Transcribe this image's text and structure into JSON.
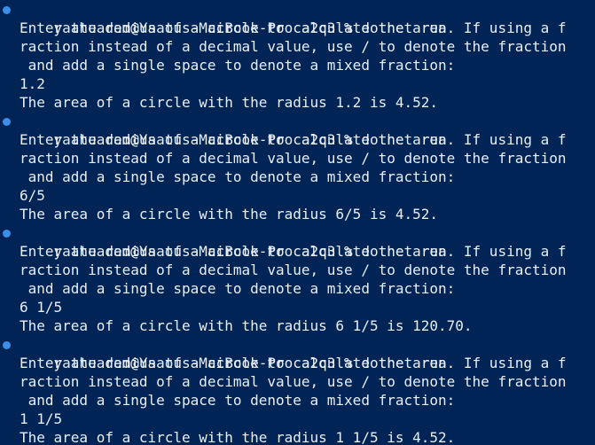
{
  "terminal": {
    "colors": {
      "background": "#012456",
      "text": "#e9eef6",
      "prompt_marker": "#3b8eea"
    },
    "sessions": [
      {
        "prompt": "yaatuadem@Yaatus-MacBook-Pro a2q3 % dotnet run",
        "output": [
          "Enter the radius of a circle to calculate the area. If using a f",
          "raction instead of a decimal value, use / to denote the fraction",
          " and add a single space to denote a mixed fraction:",
          "1.2",
          "The area of a circle with the radius 1.2 is 4.52."
        ]
      },
      {
        "prompt": "yaatuadem@Yaatus-MacBook-Pro a2q3 % dotnet run",
        "output": [
          "Enter the radius of a circle to calculate the area. If using a f",
          "raction instead of a decimal value, use / to denote the fraction",
          " and add a single space to denote a mixed fraction:",
          "6/5",
          "The area of a circle with the radius 6/5 is 4.52."
        ]
      },
      {
        "prompt": "yaatuadem@Yaatus-MacBook-Pro a2q3 % dotnet run",
        "output": [
          "Enter the radius of a circle to calculate the area. If using a f",
          "raction instead of a decimal value, use / to denote the fraction",
          " and add a single space to denote a mixed fraction:",
          "6 1/5",
          "The area of a circle with the radius 6 1/5 is 120.70."
        ]
      },
      {
        "prompt": "yaatuadem@Yaatus-MacBook-Pro a2q3 % dotnet run",
        "output": [
          "Enter the radius of a circle to calculate the area. If using a f",
          "raction instead of a decimal value, use / to denote the fraction",
          " and add a single space to denote a mixed fraction:",
          "1 1/5",
          "The area of a circle with the radius 1 1/5 is 4.52."
        ]
      }
    ]
  }
}
